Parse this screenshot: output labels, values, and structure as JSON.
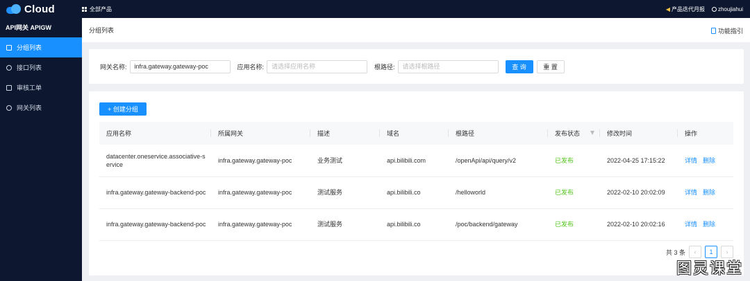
{
  "topbar": {
    "brand": "Cloud",
    "all_products": "全部产品",
    "iteration_report": "产品迭代月报",
    "username": "zhoujiahui"
  },
  "sidebar": {
    "title": "API网关 APIGW",
    "items": [
      {
        "label": "分组列表",
        "icon": "list-icon",
        "active": true
      },
      {
        "label": "接口列表",
        "icon": "link-icon",
        "active": false
      },
      {
        "label": "审核工单",
        "icon": "audit-icon",
        "active": false
      },
      {
        "label": "网关列表",
        "icon": "gateway-icon",
        "active": false
      }
    ]
  },
  "header": {
    "title": "分组列表",
    "guide": "功能指引"
  },
  "filter": {
    "gateway_label": "网关名称:",
    "gateway_value": "infra.gateway.gateway-poc",
    "app_label": "应用名称:",
    "app_placeholder": "请选择应用名称",
    "root_label": "根路径:",
    "root_placeholder": "请选择根路径",
    "query_button": "查 询",
    "reset_button": "重 置"
  },
  "create_button": "+ 创建分组",
  "table": {
    "headers": [
      "应用名称",
      "所属网关",
      "描述",
      "域名",
      "根路径",
      "发布状态",
      "修改时间",
      "操作"
    ],
    "rows": [
      {
        "app": "datacenter.oneservice.associative-service",
        "gateway": "infra.gateway.gateway-poc",
        "desc": "业务测试",
        "domain": "api.bilibili.com",
        "root": "/openApi/api/query/v2",
        "status": "已发布",
        "time": "2022-04-25 17:15:22",
        "detail": "详情",
        "delete": "删除"
      },
      {
        "app": "infra.gateway.gateway-backend-poc",
        "gateway": "infra.gateway.gateway-poc",
        "desc": "测试服务",
        "domain": "api.bilibili.co",
        "root": "/helloworld",
        "status": "已发布",
        "time": "2022-02-10 20:02:09",
        "detail": "详情",
        "delete": "删除"
      },
      {
        "app": "infra.gateway.gateway-backend-poc",
        "gateway": "infra.gateway.gateway-poc",
        "desc": "测试服务",
        "domain": "api.bilibili.co",
        "root": "/poc/backend/gateway",
        "status": "已发布",
        "time": "2022-02-10 20:02:16",
        "detail": "详情",
        "delete": "删除"
      }
    ]
  },
  "pagination": {
    "total": "共 3 条",
    "current_page": "1",
    "prev": "‹",
    "next": "›"
  },
  "watermark": "图灵课堂",
  "colors": {
    "primary": "#1890ff",
    "nav_bg": "#0d1830",
    "success": "#52c41a"
  }
}
